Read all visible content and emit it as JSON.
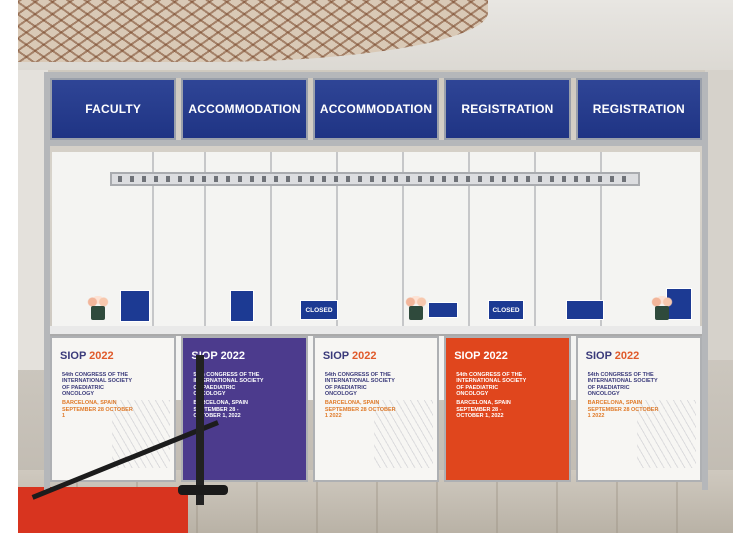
{
  "headers": [
    "FACULTY",
    "ACCOMMODATION",
    "ACCOMMODATION",
    "REGISTRATION",
    "REGISTRATION"
  ],
  "signs": {
    "closed_1": "CLOSED",
    "closed_2": "CLOSED"
  },
  "posters": [
    {
      "logo": "SIOP",
      "year": "2022",
      "line": "54th CONGRESS OF THE INTERNATIONAL SOCIETY OF PAEDIATRIC ONCOLOGY",
      "city": "BARCELONA, SPAIN SEPTEMBER 28 OCTOBER 1",
      "style": "white"
    },
    {
      "logo": "SIOP",
      "year": "2022",
      "line": "54th CONGRESS OF THE INTERNATIONAL SOCIETY OF PAEDIATRIC ONCOLOGY",
      "city": "BARCELONA, SPAIN SEPTEMBER 28 - OCTOBER 1, 2022",
      "style": "purple"
    },
    {
      "logo": "SIOP",
      "year": "2022",
      "line": "54th CONGRESS OF THE INTERNATIONAL SOCIETY OF PAEDIATRIC ONCOLOGY",
      "city": "BARCELONA, SPAIN SEPTEMBER 28 OCTOBER 1 2022",
      "style": "white"
    },
    {
      "logo": "SIOP",
      "year": "2022",
      "line": "54th CONGRESS OF THE INTERNATIONAL SOCIETY OF PAEDIATRIC ONCOLOGY",
      "city": "BARCELONA, SPAIN SEPTEMBER 28 - OCTOBER 1, 2022",
      "style": "orange"
    },
    {
      "logo": "SIOP",
      "year": "2022",
      "line": "54th CONGRESS OF THE INTERNATIONAL SOCIETY OF PAEDIATRIC ONCOLOGY",
      "city": "BARCELONA, SPAIN SEPTEMBER 28 OCTOBER 1 2022",
      "style": "white"
    }
  ],
  "colors": {
    "header_blue": "#1f3484",
    "poster_purple": "#4c3b8d",
    "poster_orange": "#e0461d",
    "carpet_red": "#d8341f"
  }
}
